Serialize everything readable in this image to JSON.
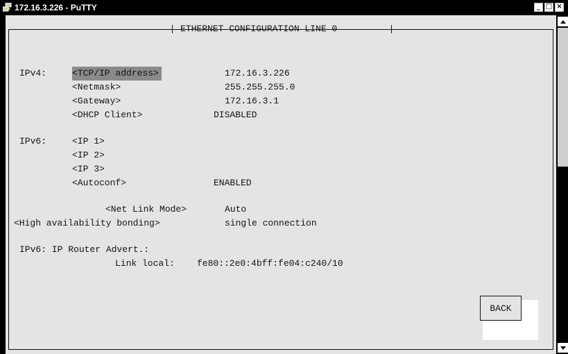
{
  "window": {
    "title": "172.16.3.226 - PuTTY",
    "minimize_glyph": "_",
    "maximize_glyph": "□",
    "close_glyph": "×"
  },
  "screen": {
    "header": "ETHERNET CONFIGURATION LINE 0",
    "ipv4": {
      "section_label": "IPv4:",
      "fields": [
        {
          "label": "<TCP/IP address>",
          "value": "172.16.3.226"
        },
        {
          "label": "<Netmask>",
          "value": "255.255.255.0"
        },
        {
          "label": "<Gateway>",
          "value": "172.16.3.1"
        },
        {
          "label": "<DHCP Client>",
          "value": "DISABLED"
        }
      ]
    },
    "ipv6": {
      "section_label": "IPv6:",
      "fields": [
        {
          "label": "<IP 1>",
          "value": ""
        },
        {
          "label": "<IP 2>",
          "value": ""
        },
        {
          "label": "<IP 3>",
          "value": ""
        },
        {
          "label": "<Autoconf>",
          "value": "ENABLED"
        }
      ]
    },
    "net_link_mode": {
      "label": "<Net Link Mode>",
      "value": "Auto"
    },
    "ha_bonding": {
      "label": "<High availability bonding>",
      "value": "single connection"
    },
    "router_advert": {
      "heading": "IPv6: IP Router Advert.:",
      "link_local_label": "Link local:",
      "link_local_value": "fe80::2e0:4bff:fe04:c240/10"
    },
    "back_label": "BACK"
  }
}
